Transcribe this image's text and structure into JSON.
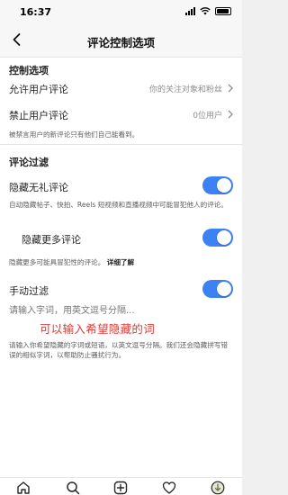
{
  "status_bar": {
    "time": "16:37"
  },
  "nav": {
    "title": "评论控制选项"
  },
  "controls": {
    "section_title": "控制选项",
    "allow_comments": {
      "label": "允许用户评论",
      "value": "你的关注对象和粉丝"
    },
    "block_comments": {
      "label": "禁止用户评论",
      "value": "0位用户"
    },
    "block_hint": "被禁言用户的新评论只有他们自己能看到。"
  },
  "filters": {
    "section_title": "评论过滤",
    "hide_offensive": {
      "label": "隐藏无礼评论",
      "enabled": true,
      "hint": "自动隐藏帖子、快拍、Reels 短视频和直播视频中可能冒犯他人的评论。"
    },
    "hide_more": {
      "label": "隐藏更多评论",
      "enabled": true,
      "hint": "隐藏更多可能具冒犯性的评论。",
      "learn_more": "详细了解"
    },
    "manual_filter": {
      "label": "手动过滤",
      "enabled": true,
      "placeholder": "请输入字词，用英文逗号分隔...",
      "annotation": "可以输入希望隐藏的词",
      "hint": "请输入你希望隐藏的字词或短语，以英文逗号分隔。我们还会隐藏拼写错误的相似字词，以帮助防止骚扰行为。"
    }
  },
  "colors": {
    "toggle_on": "#3d82f5",
    "annotation": "#e53935"
  },
  "tabbar": {
    "icons": [
      "home-icon",
      "search-icon",
      "create-icon",
      "heart-icon",
      "profile-icon"
    ]
  }
}
